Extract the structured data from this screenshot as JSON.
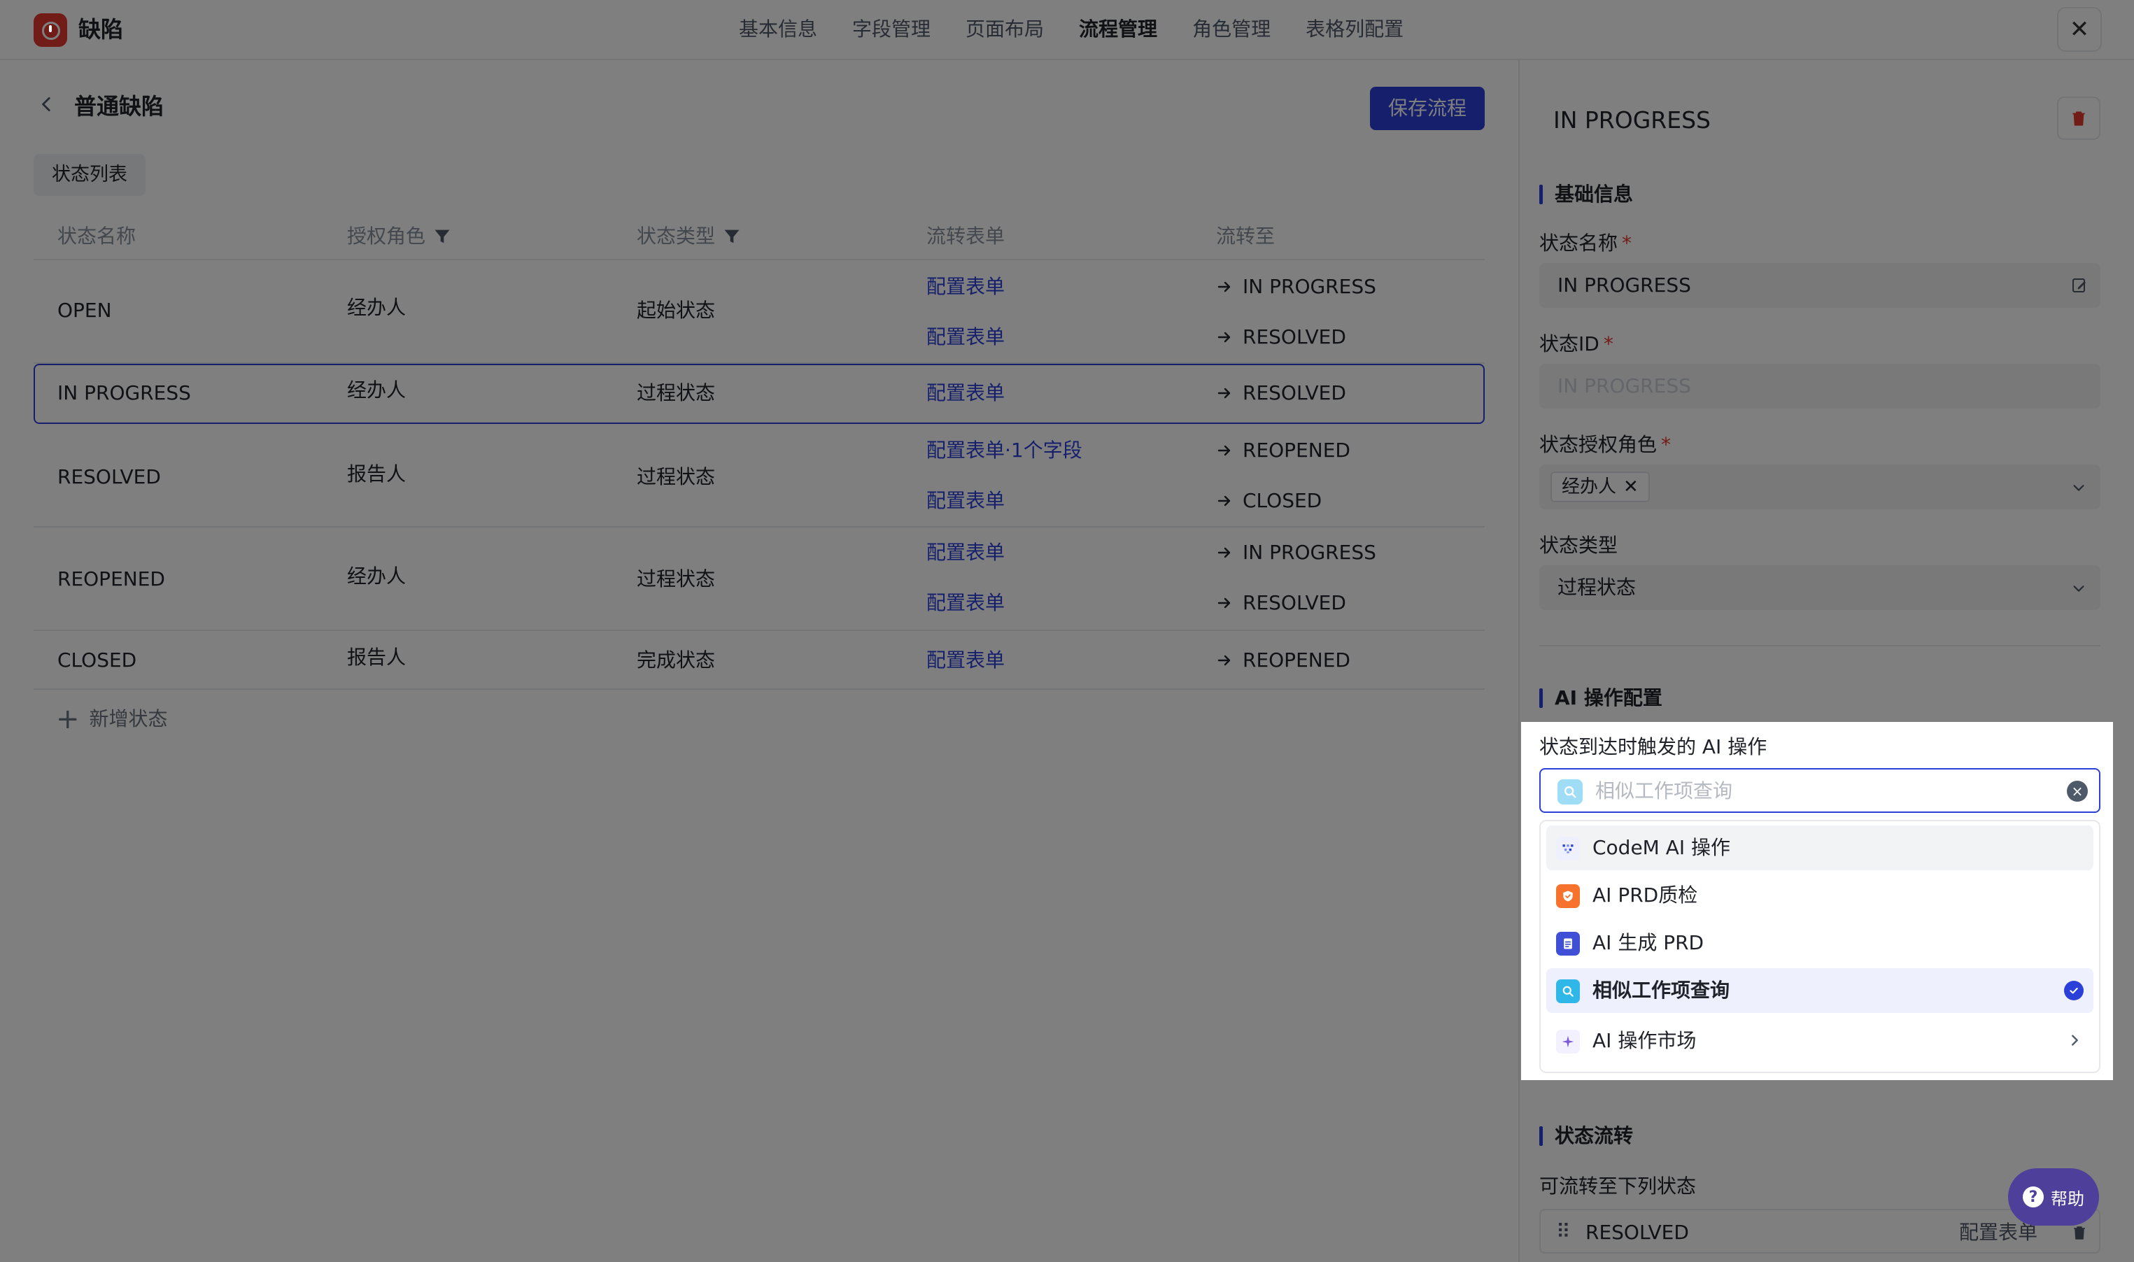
{
  "app": {
    "title": "缺陷",
    "logo_icon": "bug-alert-icon",
    "brand_color": "#e4382f",
    "accent_color": "#2b3fd9"
  },
  "top_tabs": [
    {
      "label": "基本信息",
      "active": false
    },
    {
      "label": "字段管理",
      "active": false
    },
    {
      "label": "页面布局",
      "active": false
    },
    {
      "label": "流程管理",
      "active": true
    },
    {
      "label": "角色管理",
      "active": false
    },
    {
      "label": "表格列配置",
      "active": false
    }
  ],
  "main": {
    "title": "普通缺陷",
    "save_label": "保存流程",
    "section_chip": "状态列表",
    "columns": [
      "状态名称",
      "授权角色",
      "状态类型",
      "流转表单",
      "流转至"
    ],
    "rows": [
      {
        "name": "OPEN",
        "role": "经办人",
        "type": "起始状态",
        "transitions": [
          {
            "form": "配置表单",
            "to": "IN PROGRESS"
          },
          {
            "form": "配置表单",
            "to": "RESOLVED"
          }
        ]
      },
      {
        "name": "IN PROGRESS",
        "role": "经办人",
        "type": "过程状态",
        "transitions": [
          {
            "form": "配置表单",
            "to": "RESOLVED"
          }
        ]
      },
      {
        "name": "RESOLVED",
        "role": "报告人",
        "type": "过程状态",
        "transitions": [
          {
            "form": "配置表单·1个字段",
            "to": "REOPENED"
          },
          {
            "form": "配置表单",
            "to": "CLOSED"
          }
        ]
      },
      {
        "name": "REOPENED",
        "role": "经办人",
        "type": "过程状态",
        "transitions": [
          {
            "form": "配置表单",
            "to": "IN PROGRESS"
          },
          {
            "form": "配置表单",
            "to": "RESOLVED"
          }
        ]
      },
      {
        "name": "CLOSED",
        "role": "报告人",
        "type": "完成状态",
        "transitions": [
          {
            "form": "配置表单",
            "to": "REOPENED"
          }
        ]
      }
    ],
    "add_state_label": "新增状态"
  },
  "panel": {
    "title": "IN PROGRESS",
    "basic_section": "基础信息",
    "state_name_label": "状态名称",
    "state_name_value": "IN PROGRESS",
    "state_id_label": "状态ID",
    "state_id_value": "IN PROGRESS",
    "role_label": "状态授权角色",
    "role_tag": "经办人",
    "type_label": "状态类型",
    "type_value": "过程状态",
    "ai_section": "AI 操作配置",
    "flow_section": "状态流转",
    "flow_label": "可流转至下列状态",
    "flow_rows": [
      {
        "name": "RESOLVED",
        "form": "配置表单"
      }
    ]
  },
  "ai_popup": {
    "label": "状态到达时触发的 AI 操作",
    "search_placeholder": "相似工作项查询",
    "options": [
      {
        "label": "CodeM AI 操作",
        "icon": "codem-icon",
        "icon_color": "#eef1fd",
        "state": "hover"
      },
      {
        "label": "AI PRD质检",
        "icon": "shield-check-icon",
        "icon_color": "#f7722c",
        "state": ""
      },
      {
        "label": "AI 生成 PRD",
        "icon": "document-icon",
        "icon_color": "#3f4fd6",
        "state": ""
      },
      {
        "label": "相似工作项查询",
        "icon": "search-icon",
        "icon_color": "#2fb7e8",
        "state": "selected"
      },
      {
        "label": "AI 操作市场",
        "icon": "sparkle-icon",
        "icon_color": "#f3f0ff",
        "state": "submenu"
      }
    ]
  },
  "help": {
    "label": "帮助"
  }
}
